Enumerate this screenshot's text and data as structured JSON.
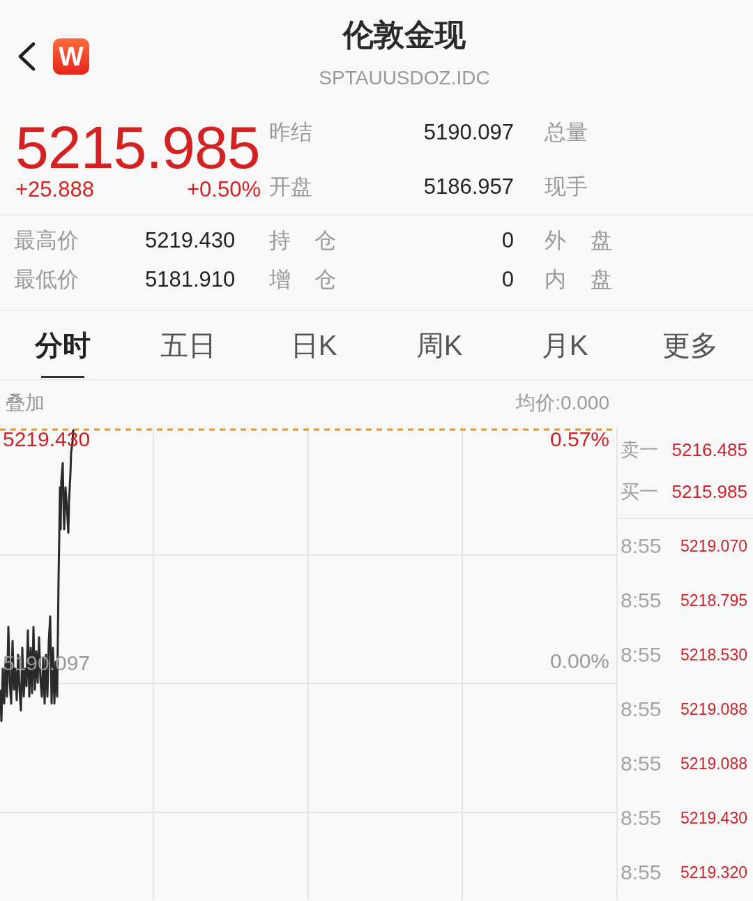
{
  "header": {
    "logo_letter": "W",
    "title": "伦敦金现",
    "code": "SPTAUUSDOZ.IDC"
  },
  "quote": {
    "price": "5215.985",
    "change": "+25.888",
    "change_pct": "+0.50%",
    "rising": true,
    "rows": [
      {
        "label": "昨结",
        "value": "5190.097",
        "label_2": "总量"
      },
      {
        "label": "开盘",
        "value": "5186.957",
        "label_2": "现手"
      }
    ]
  },
  "stats": [
    {
      "label": "最高价",
      "value": "5219.430",
      "label_2": "持 仓",
      "value_2": "0",
      "label_3": "外 盘"
    },
    {
      "label": "最低价",
      "value": "5181.910",
      "label_2": "增 仓",
      "value_2": "0",
      "label_3": "内 盘"
    }
  ],
  "tabs": [
    {
      "label": "分时",
      "selected": true
    },
    {
      "label": "五日",
      "selected": false
    },
    {
      "label": "日K",
      "selected": false
    },
    {
      "label": "周K",
      "selected": false
    },
    {
      "label": "月K",
      "selected": false
    },
    {
      "label": "更多",
      "selected": false
    }
  ],
  "chart": {
    "overlay": "叠加",
    "average": "均价:0.000",
    "high_price": "5219.430",
    "high_pct": "0.57%",
    "base_price": "5190.097",
    "base_pct": "0.00%"
  },
  "order_book": [
    {
      "label": "卖一",
      "price": "5216.485"
    },
    {
      "label": "买一",
      "price": "5215.985"
    }
  ],
  "ticks": [
    {
      "time": "8:55",
      "price": "5219.070"
    },
    {
      "time": "8:55",
      "price": "5218.795"
    },
    {
      "time": "8:55",
      "price": "5218.530"
    },
    {
      "time": "8:55",
      "price": "5219.088"
    },
    {
      "time": "8:55",
      "price": "5219.088"
    },
    {
      "time": "8:55",
      "price": "5219.430"
    },
    {
      "time": "8:55",
      "price": "5219.320"
    }
  ]
}
